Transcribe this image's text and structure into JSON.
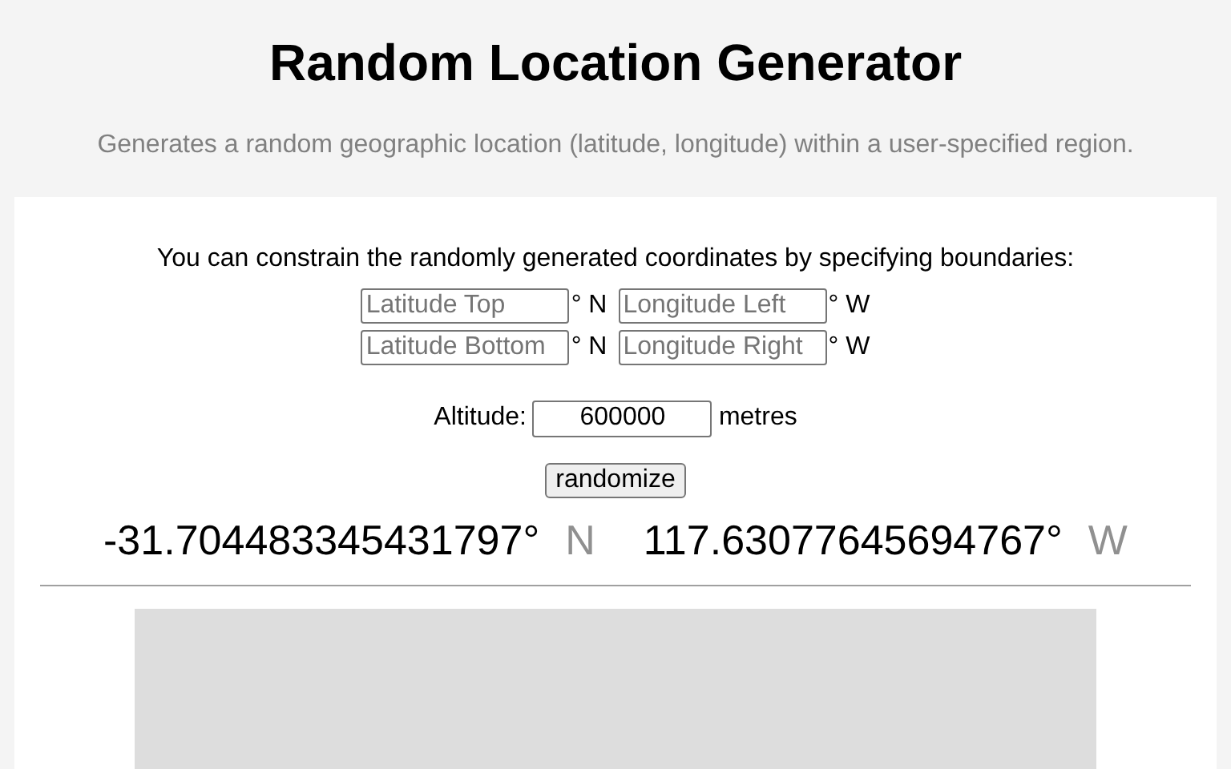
{
  "title": "Random Location Generator",
  "subtitle": "Generates a random geographic location (latitude, longitude) within a user-specified region.",
  "instructions": "You can constrain the randomly generated coordinates by specifying boundaries:",
  "bounds": [
    [
      {
        "placeholder": "Latitude Top",
        "unit": "° N"
      },
      {
        "placeholder": "Longitude Left",
        "unit": "° W"
      }
    ],
    [
      {
        "placeholder": "Latitude Bottom",
        "unit": "° N"
      },
      {
        "placeholder": "Longitude Right",
        "unit": "° W"
      }
    ]
  ],
  "altitude": {
    "label": "Altitude:",
    "value": "600000",
    "unit": "metres"
  },
  "button": "randomize",
  "result": [
    {
      "value": "-31.704483345431797°",
      "direction": "N"
    },
    {
      "value": "117.63077645694767°",
      "direction": "W"
    }
  ]
}
